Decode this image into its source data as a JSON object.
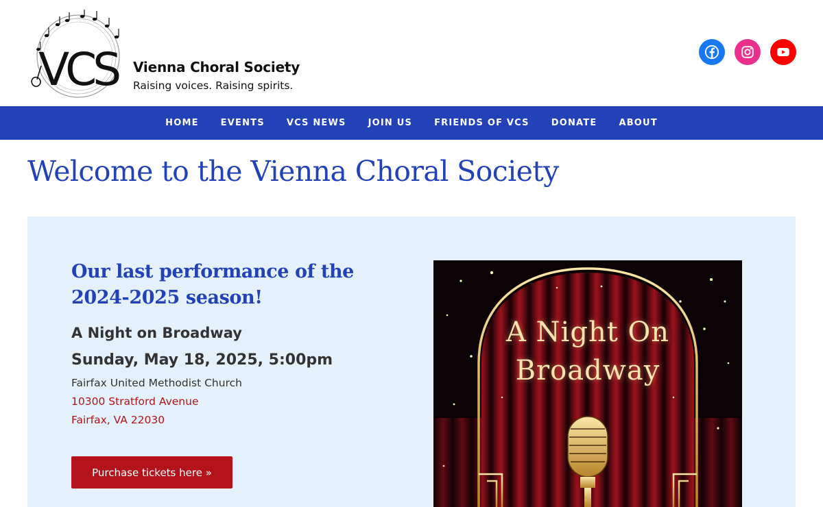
{
  "site": {
    "logo_monogram": "VCS",
    "title": "Vienna Choral Society",
    "tagline": "Raising voices. Raising spirits."
  },
  "social": {
    "facebook": "Facebook",
    "instagram": "Instagram",
    "youtube": "YouTube"
  },
  "nav": {
    "items": [
      {
        "label": "HOME"
      },
      {
        "label": "EVENTS"
      },
      {
        "label": "VCS NEWS"
      },
      {
        "label": "JOIN US"
      },
      {
        "label": "FRIENDS OF VCS"
      },
      {
        "label": "DONATE"
      },
      {
        "label": "ABOUT"
      }
    ]
  },
  "page": {
    "title": "Welcome to the Vienna Choral Society"
  },
  "feature": {
    "intro": "Our last performance of the 2024-2025 season!",
    "event_name": "A Night on Broadway",
    "event_date": "Sunday, May 18, 2025, 5:00pm",
    "venue": "Fairfax United Methodist Church",
    "address_line1": "10300 Stratford Avenue",
    "address_line2": "Fairfax, VA 22030",
    "button_label": "Purchase tickets here »",
    "poster": {
      "line1": "A Night On",
      "line2": "Broadway"
    }
  },
  "colors": {
    "brand_blue": "#2342b7",
    "accent_red": "#b3141b",
    "panel_bg": "#e4f1fa",
    "facebook": "#1877f2",
    "instagram": "#ea2f8c",
    "youtube": "#ff0000"
  },
  "icons": {
    "facebook": "facebook-icon",
    "instagram": "instagram-icon",
    "youtube": "youtube-icon"
  }
}
